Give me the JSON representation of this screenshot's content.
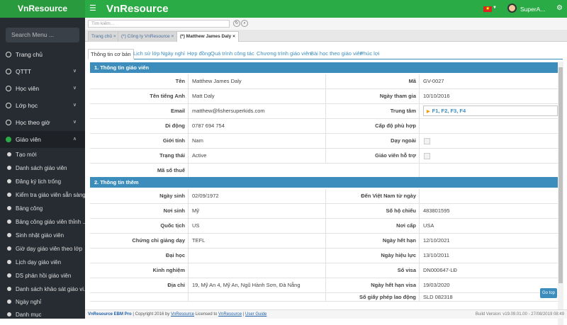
{
  "app": {
    "brand": "VnResource",
    "title": "VnResource",
    "user": "SuperA...",
    "flag_color": "#da251d",
    "accent": "#2bab45",
    "section_color": "#3c8dbc",
    "hamburger_icon": "hamburger-icon",
    "gear_icon": "gear-icon"
  },
  "sidebar": {
    "search_placeholder": "Search Menu ...",
    "items": [
      {
        "label": "Trang chủ",
        "icon": "home-icon"
      },
      {
        "label": "QTTT",
        "icon": "circle-icon"
      },
      {
        "label": "Học viên",
        "icon": "user-icon"
      },
      {
        "label": "Lớp học",
        "icon": "class-icon"
      },
      {
        "label": "Học theo giờ",
        "icon": "clock-icon"
      },
      {
        "label": "Giáo viên",
        "icon": "teacher-icon"
      }
    ],
    "sub_items": [
      "Tạo mới",
      "Danh sách giáo viên",
      "Đăng ký lịch trống",
      "Kiểm tra giáo viên sẵn sàng",
      "Bảng công",
      "Bảng công giáo viên thỉnh ...",
      "Sinh nhật giáo viên",
      "Giờ dạy giáo viên theo lớp",
      "Lịch dạy giáo viên",
      "DS phản hồi giáo viên",
      "Danh sách khảo sát giáo vi...",
      "Ngày nghỉ",
      "Danh mục"
    ]
  },
  "toolbar": {
    "search_placeholder": "Tìm kiếm..."
  },
  "page_tabs": [
    "Trang chủ",
    "(*) Công ty VnResource",
    "(*) Matthew James Daly"
  ],
  "content_tabs": [
    "Thông tin cơ bản",
    "Lịch sử lớp",
    "Ngày nghỉ",
    "Hợp đồng",
    "Quá trình công tác",
    "Chương trình giáo viên",
    "Bài học theo giáo viên",
    "Phúc lợi"
  ],
  "section1": {
    "title": "1. Thông tin giáo viên",
    "rows": [
      {
        "l1": "Tên",
        "v1": "Matthew James Daly",
        "l2": "Mã",
        "v2": "GV-0027"
      },
      {
        "l1": "Tên tiếng Anh",
        "v1": "Matt Daly",
        "l2": "Ngày tham gia",
        "v2": "10/10/2016"
      },
      {
        "l1": "Email",
        "v1": "matthew@fishersuperkids.com",
        "l2": "Trung tâm",
        "v2": "F1, F2, F3, F4"
      },
      {
        "l1": "Di động",
        "v1": "0787 694 754",
        "l2": "Cấp độ phù hợp",
        "v2": ""
      },
      {
        "l1": "Giới tính",
        "v1": "Nam",
        "l2": "Dạy ngoài",
        "v2": ""
      },
      {
        "l1": "Trạng thái",
        "v1": "Active",
        "l2": "Giáo viên hỗ trợ",
        "v2": ""
      },
      {
        "l1": "Mã số thuế",
        "v1": "",
        "l2": "",
        "v2": ""
      }
    ]
  },
  "section2": {
    "title": "2. Thông tin thêm",
    "rows": [
      {
        "l1": "Ngày sinh",
        "v1": "02/09/1972",
        "l2": "Đến Việt Nam từ ngày",
        "v2": ""
      },
      {
        "l1": "Nơi sinh",
        "v1": "Mỹ",
        "l2": "Số hộ chiếu",
        "v2": "483801595"
      },
      {
        "l1": "Quốc tịch",
        "v1": "US",
        "l2": "Nơi cấp",
        "v2": "USA"
      },
      {
        "l1": "Chứng chỉ giảng dạy",
        "v1": "TEFL",
        "l2": "Ngày hết hạn",
        "v2": "12/10/2021"
      },
      {
        "l1": "Đại học",
        "v1": "",
        "l2": "Ngày hiệu lực",
        "v2": "13/10/2011"
      },
      {
        "l1": "Kinh nghiệm",
        "v1": "",
        "l2": "Số visa",
        "v2": "DN000647-LĐ"
      },
      {
        "l1": "Địa chỉ",
        "v1": "19, Mỹ An 4, Mỹ An, Ngũ Hành Sơn, Đà Nẵng",
        "l2": "Ngày hết hạn visa",
        "v2": "19/03/2020"
      },
      {
        "l1": "",
        "v1": "",
        "l2": "Số giấy phép lao động",
        "v2": "SLD 082318"
      }
    ]
  },
  "go_top": "Go top",
  "footer": {
    "product": "VnResource EBM Pro",
    "copyright": "| Copyright 2016 by",
    "c1": "VnResource",
    "licensed": "Licensed to",
    "c2": "VnResource",
    "sep": "|",
    "guide": "User Guide",
    "build": "Build Version: v19.09.01.00 - 27/08/2019 08:49"
  }
}
